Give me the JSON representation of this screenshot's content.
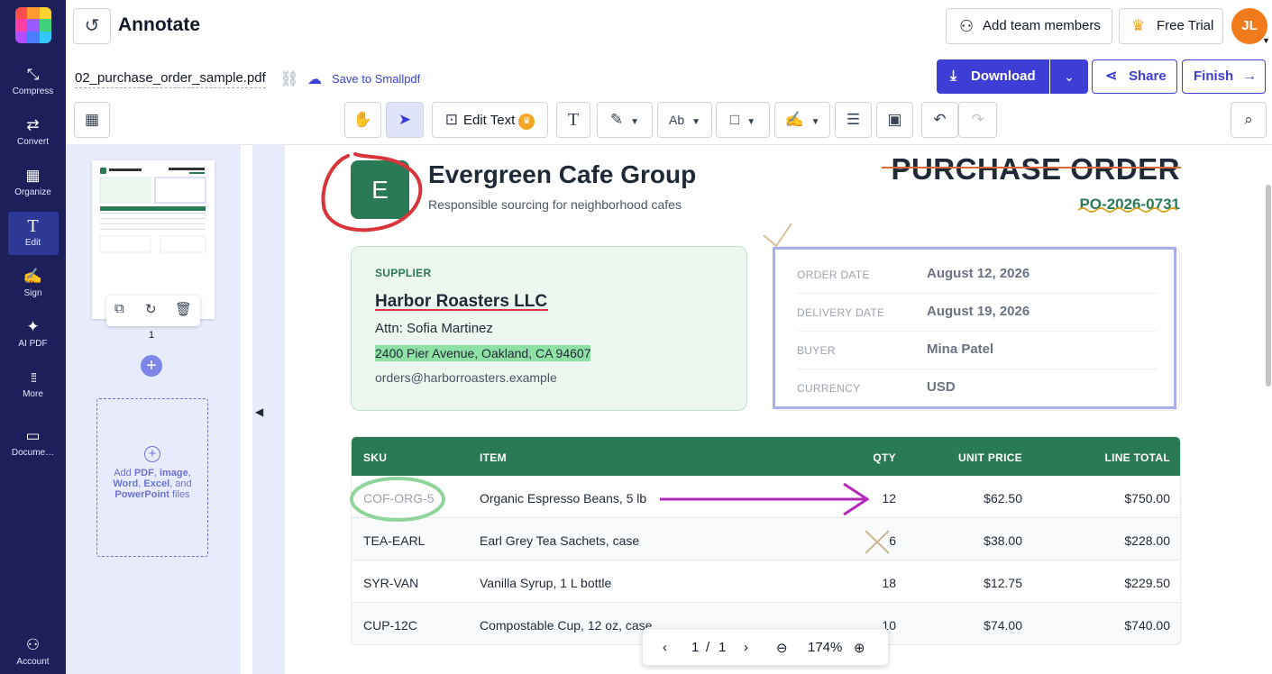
{
  "app": {
    "title": "Annotate"
  },
  "rail": {
    "items": [
      {
        "label": "Compress",
        "icon": "compress-icon",
        "glyph": "⤡"
      },
      {
        "label": "Convert",
        "icon": "convert-icon",
        "glyph": "⇄"
      },
      {
        "label": "Organize",
        "icon": "organize-icon",
        "glyph": "▦"
      },
      {
        "label": "Edit",
        "icon": "edit-text-icon",
        "glyph": "T"
      },
      {
        "label": "Sign",
        "icon": "signature-icon",
        "glyph": "✍"
      },
      {
        "label": "AI PDF",
        "icon": "sparkle-icon",
        "glyph": "✦"
      },
      {
        "label": "More",
        "icon": "grid-dots-icon",
        "glyph": "⋮⋮"
      },
      {
        "label": "Docume…",
        "icon": "folder-icon",
        "glyph": "▭"
      }
    ],
    "account_label": "Account"
  },
  "header": {
    "add_team_label": "Add team members",
    "free_trial_label": "Free Trial",
    "avatar_initials": "JL"
  },
  "file": {
    "name": "02_purchase_order_sample.pdf",
    "save_label": "Save to Smallpdf"
  },
  "actions": {
    "download_label": "Download",
    "share_label": "Share",
    "finish_label": "Finish"
  },
  "toolbar": {
    "edit_text_label": "Edit Text"
  },
  "sidebar": {
    "page_number": "1",
    "drop_prefix": "Add ",
    "drop_pdf": "PDF",
    "drop_image": "image",
    "drop_word": "Word",
    "drop_excel": "Excel",
    "drop_and": "and",
    "drop_ppt": "PowerPoint",
    "drop_suffix": "files"
  },
  "document": {
    "logo_letter": "E",
    "company": "Evergreen Cafe Group",
    "tagline": "Responsible sourcing for neighborhood cafes",
    "title": "PURCHASE ORDER",
    "po_number": "PO-2026-0731",
    "supplier": {
      "label": "SUPPLIER",
      "name": "Harbor Roasters LLC",
      "attn": "Attn: Sofia Martinez",
      "address": "2400 Pier Avenue, Oakland, CA 94607",
      "email": "orders@harborroasters.example"
    },
    "meta": [
      {
        "key": "ORDER DATE",
        "value": "August 12, 2026"
      },
      {
        "key": "DELIVERY DATE",
        "value": "August 19, 2026"
      },
      {
        "key": "BUYER",
        "value": "Mina Patel"
      },
      {
        "key": "CURRENCY",
        "value": "USD"
      }
    ],
    "table": {
      "headers": [
        "SKU",
        "ITEM",
        "QTY",
        "UNIT PRICE",
        "LINE TOTAL"
      ],
      "rows": [
        [
          "COF-ORG-5",
          "Organic Espresso Beans, 5 lb",
          "12",
          "$62.50",
          "$750.00"
        ],
        [
          "TEA-EARL",
          "Earl Grey Tea Sachets, case",
          "6",
          "$38.00",
          "$228.00"
        ],
        [
          "SYR-VAN",
          "Vanilla Syrup, 1 L bottle",
          "18",
          "$12.75",
          "$229.50"
        ],
        [
          "CUP-12C",
          "Compostable Cup, 12 oz, case",
          "10",
          "$74.00",
          "$740.00"
        ]
      ]
    }
  },
  "pager": {
    "current": "1",
    "separator": "/",
    "total": "1",
    "zoom": "174%"
  },
  "colors": {
    "brand_navy": "#1c1f5a",
    "accent_blue": "#3d3ed6",
    "doc_green": "#2a7a55"
  }
}
